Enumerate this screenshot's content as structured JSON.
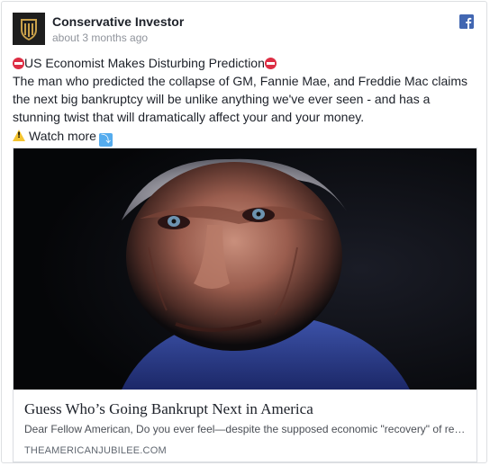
{
  "post": {
    "page_name": "Conservative Investor",
    "timestamp": "about 3 months ago",
    "platform_icon": "facebook-icon",
    "headline": "US Economist Makes Disturbing Prediction",
    "body": "The man who predicted the collapse of GM, Fannie Mae, and Freddie Mac claims the next big bankruptcy will be unlike anything we've ever seen - and has a stunning twist that will dramatically affect your and your money.",
    "watch_more": "Watch more"
  },
  "link": {
    "title": "Guess Who’s Going Bankrupt Next in America",
    "description": "Dear Fellow American, Do you ever feel—despite the supposed economic \"recovery\" of recent years…",
    "domain": "THEAMERICANJUBILEE.COM"
  },
  "colors": {
    "brand_blue": "#4267b2",
    "text": "#1d2129",
    "muted": "#90949c"
  }
}
